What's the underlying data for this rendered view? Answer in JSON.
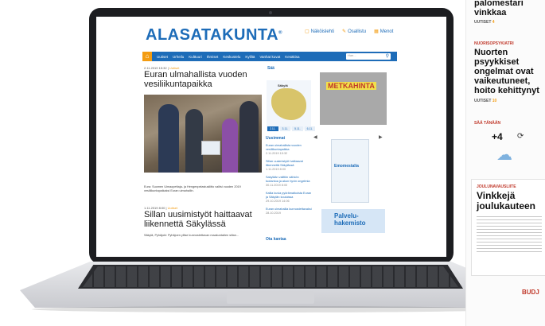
{
  "site": {
    "logo": "ALASATAKUNTA",
    "top_links": [
      {
        "icon": "square-icon",
        "label": "Näköislehti"
      },
      {
        "icon": "pen-icon",
        "label": "Osallistu"
      },
      {
        "icon": "calendar-icon",
        "label": "Menot"
      }
    ],
    "nav": [
      "Uutiset",
      "Urheilu",
      "Kulttuuri",
      "Ihmiset",
      "Keskustelu",
      "Kyliltä",
      "Vanhat kuvat",
      "Kesäkisa"
    ],
    "article1": {
      "date": "2.11.2019 15:32",
      "category": "Uutiset",
      "title": "Euran ulmahallista vuoden vesiliikuntapaikka",
      "caption": "Eura: Suomen Uimaopettaja- ja Hengenpelastusliitto valitsi vuoden 2019 vesiliikuntapaikaksi Euran uimahallin."
    },
    "article2": {
      "date": "1.11.2019 8:00",
      "category": "Uutiset",
      "title": "Sillan uusimistyöt haittaavat liikennettä Säkylässä",
      "caption": "Säkylä, Pyhäjoki: Pyhäjoen ylitse kunnostettavan maakuntatien sillan..."
    },
    "weather": {
      "heading": "Sää",
      "place": "Säkylä",
      "tabs": [
        "2.11.",
        "3.11.",
        "5.11.",
        "6.11."
      ]
    },
    "latest": {
      "heading": "Uusimmat",
      "items": [
        {
          "title": "Euran uimahallista vuoden vesiliikuntapaikka",
          "time": "2.11.2019 15:32"
        },
        {
          "title": "Sillan uusimistyöt haittaavat liikennettä Säkylässä",
          "time": "1.11.2019 8:00"
        },
        {
          "title": "Sakylään valittiin sähkön tuotantoa ja akun hyvin ongelmia",
          "time": "30.11.2019 8:00"
        },
        {
          "title": "Kallia kuvia pyörämatkoista Euran ja Säkylän kouluissa",
          "time": "29.10.2019 14:06"
        },
        {
          "title": "Euran uimahallia kunnostettavaksi",
          "time": "28.10.2019"
        }
      ]
    },
    "poll_heading": "Ota kantaa",
    "ads": {
      "ad1": "METKAHINTA",
      "ad3": "Palvelu-hakemisto",
      "ad2": "Emomestalia"
    },
    "search_placeholder": "Hae..."
  },
  "paper": {
    "top_headline": "palomestari vinkkaa",
    "top_meta": {
      "label": "UUTISET",
      "num": "4"
    },
    "kicker": "NUORISOPSYKIATRI",
    "headline": "Nuorten psyykkiset ongelmat ovat vaikeutuneet, hoito kehittynyt",
    "meta": {
      "label": "UUTISET",
      "num": "10"
    },
    "weather_label": "SÄÄ TÄNÄÄN",
    "temperature": "+4",
    "kicker2": "JOULUNAVAUSLIITE",
    "headline2": "Vinkkejä joulukauteen",
    "footer": "BUDJ"
  },
  "colors": {
    "brand": "#1d6cb8",
    "accent": "#f39c12",
    "news_red": "#c0392b"
  }
}
